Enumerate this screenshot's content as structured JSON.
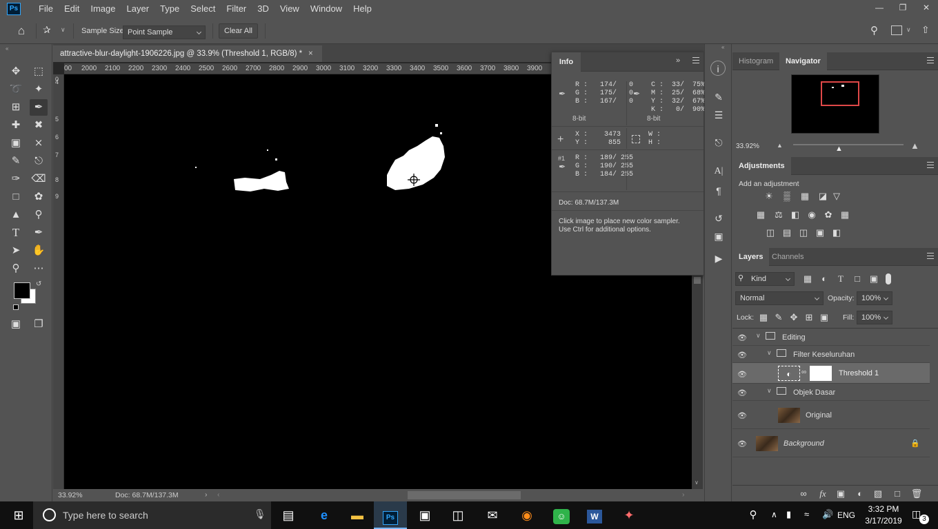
{
  "app": {
    "logo": "Ps"
  },
  "menu": [
    "File",
    "Edit",
    "Image",
    "Layer",
    "Type",
    "Select",
    "Filter",
    "3D",
    "View",
    "Window",
    "Help"
  ],
  "window_controls": [
    "minimize-icon",
    "restore-icon",
    "close-icon"
  ],
  "options": {
    "sample_size_label": "Sample Size:",
    "sample_size_value": "Point Sample",
    "clear_all": "Clear All"
  },
  "document": {
    "tab_title": "attractive-blur-daylight-1906226.jpg @ 33.9% (Threshold 1, RGB/8) *",
    "close": "×",
    "ruler_h": [
      "00",
      "2000",
      "2100",
      "2200",
      "2300",
      "2400",
      "2500",
      "2600",
      "2700",
      "2800",
      "2900",
      "3000",
      "3100",
      "3200",
      "3300",
      "3400",
      "3500",
      "3600",
      "3700",
      "3800",
      "3900"
    ],
    "ruler_v": [
      "0",
      "4",
      "5",
      "6",
      "7",
      "8",
      "9"
    ],
    "zoom": "33.92%",
    "doc_size": "Doc: 68.7M/137.3M"
  },
  "info": {
    "title": "Info",
    "rgb1": "R :   174/   0\nG :   175/   0\nB :   167/   0",
    "bit1": "8-bit",
    "cmyk": "C :  33/  75%\nM :  25/  68%\nY :  32/  67%\nK :   0/  90%",
    "bit2": "8-bit",
    "xy": "X :    3473\nY :     855",
    "wh": "W :\nH :",
    "sampler_label": "#1",
    "rgb2": "R :   189/ 255\nG :   190/ 255\nB :   184/ 255",
    "doc": "Doc: 68.7M/137.3M",
    "hint1": "Click image to place new color sampler.",
    "hint2": "Use Ctrl for additional options."
  },
  "navigator": {
    "tabs": [
      "Histogram",
      "Navigator"
    ],
    "zoom": "33.92%"
  },
  "adjustments": {
    "title": "Adjustments",
    "subtitle": "Add an adjustment"
  },
  "layers": {
    "tabs": [
      "Layers",
      "Channels"
    ],
    "kind": "Kind",
    "blend_mode": "Normal",
    "opacity_label": "Opacity:",
    "opacity": "100%",
    "lock_label": "Lock:",
    "fill_label": "Fill:",
    "fill": "100%",
    "items": [
      {
        "name": "Editing",
        "type": "group"
      },
      {
        "name": "Filter Keseluruhan",
        "type": "group"
      },
      {
        "name": "Threshold 1",
        "type": "adjustment"
      },
      {
        "name": "Objek Dasar",
        "type": "group"
      },
      {
        "name": "Original",
        "type": "pixel"
      },
      {
        "name": "Background",
        "type": "background"
      }
    ]
  },
  "taskbar": {
    "search_placeholder": "Type here to search",
    "lang": "ENG",
    "time": "3:32 PM",
    "date": "3/17/2019",
    "notifications": "3"
  }
}
